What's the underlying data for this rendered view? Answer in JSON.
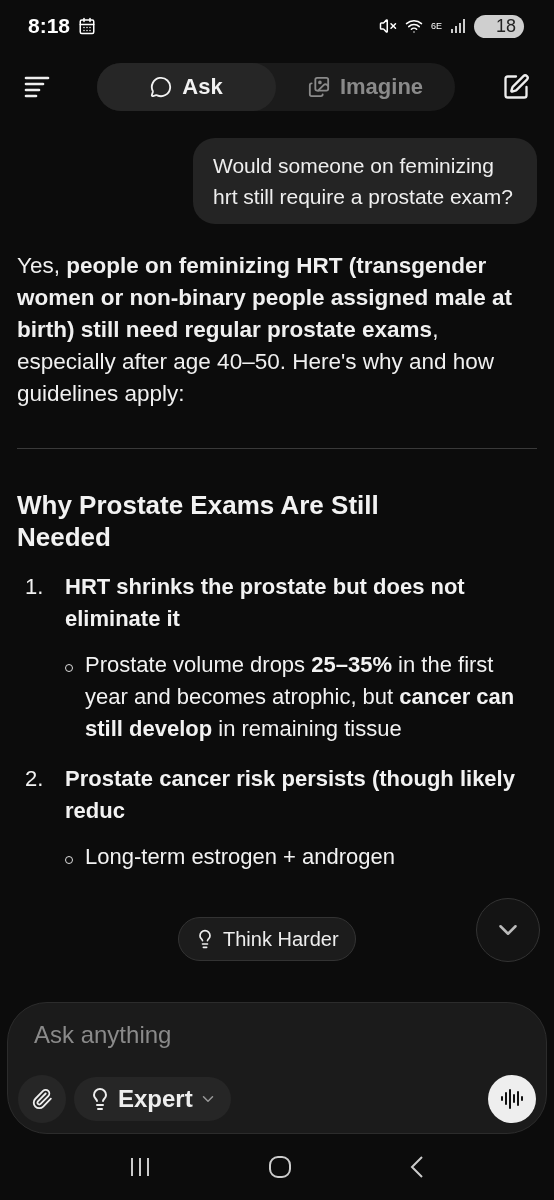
{
  "status_bar": {
    "time": "8:18",
    "network": "6E",
    "battery": "18"
  },
  "tabs": [
    {
      "label": "Ask",
      "selected": true,
      "kind": "chat"
    },
    {
      "label": "Imagine",
      "selected": false,
      "kind": "images"
    }
  ],
  "user_message": "Would someone on feminizing hrt still require a prostate exam?",
  "response": {
    "intro": "Yes, **people on feminizing HRT (transgender women or non-binary people assigned male at birth) still need regular prostate exams**, especially after age 40–50. Here's why and how guidelines apply:",
    "heading": "Why Prostate Exams Are Still Needed",
    "items": [
      {
        "number": "1.",
        "title": "HRT shrinks the prostate but does not eliminate it",
        "bullets": [
          "Prostate volume drops **25–35%** in the first year and becomes atrophic, but **cancer can still develop** in remaining tissue"
        ]
      },
      {
        "number": "2.",
        "title": "Prostate cancer risk persists (though likely reduc",
        "bullets": [
          "Long-term estrogen + androgen"
        ]
      }
    ]
  },
  "think_harder": "Think Harder",
  "composer": {
    "placeholder": "Ask anything",
    "mode": "Expert"
  }
}
